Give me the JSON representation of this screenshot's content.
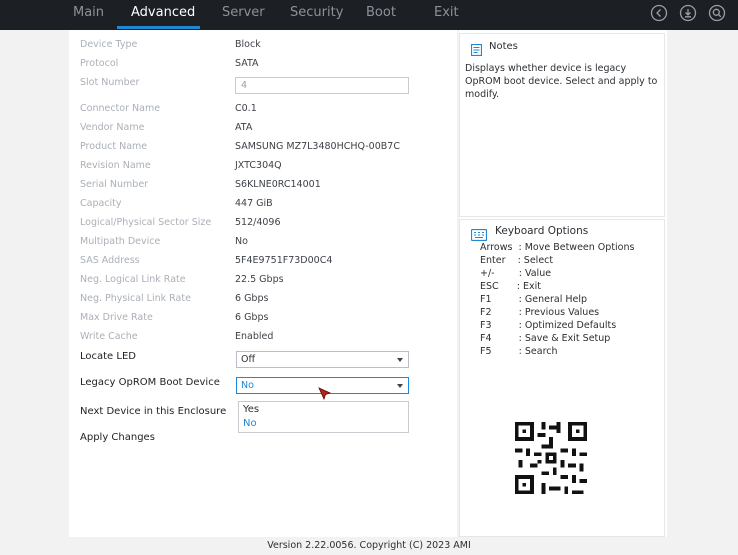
{
  "topbar": {
    "tabs": [
      {
        "label": "Main"
      },
      {
        "label": "Advanced"
      },
      {
        "label": "Server"
      },
      {
        "label": "Security"
      },
      {
        "label": "Boot"
      },
      {
        "label": "Exit"
      }
    ],
    "active_tab": "Advanced"
  },
  "device": {
    "rows": [
      {
        "label": "Device Type",
        "value": "Block"
      },
      {
        "label": "Protocol",
        "value": "SATA"
      },
      {
        "label": "Slot Number",
        "value": "4"
      },
      {
        "label": "Connector Name",
        "value": "C0.1"
      },
      {
        "label": "Vendor Name",
        "value": "ATA"
      },
      {
        "label": "Product Name",
        "value": "SAMSUNG MZ7L3480HCHQ-00B7C"
      },
      {
        "label": "Revision Name",
        "value": "JXTC304Q"
      },
      {
        "label": "Serial Number",
        "value": "S6KLNE0RC14001"
      },
      {
        "label": "Capacity",
        "value": "447 GiB"
      },
      {
        "label": "Logical/Physical Sector Size",
        "value": "512/4096"
      },
      {
        "label": "Multipath Device",
        "value": "No"
      },
      {
        "label": "SAS Address",
        "value": "5F4E9751F73D00C4"
      },
      {
        "label": "Neg. Logical Link Rate",
        "value": "22.5 Gbps"
      },
      {
        "label": "Neg. Physical Link Rate",
        "value": "6 Gbps"
      },
      {
        "label": "Max Drive Rate",
        "value": "6 Gbps"
      },
      {
        "label": "Write Cache",
        "value": "Enabled"
      }
    ],
    "locate_led": {
      "label": "Locate LED",
      "value": "Off"
    },
    "legacy_oprom": {
      "label": "Legacy OpROM Boot Device",
      "value": "No"
    },
    "next_device": {
      "label": "Next Device in this Enclosure"
    },
    "apply_changes": {
      "label": "Apply Changes"
    },
    "dropdown_options": [
      "Yes",
      "No"
    ],
    "dropdown_selected": "No"
  },
  "notes": {
    "title": "Notes",
    "text": "Displays whether device is legacy OpROM boot device. Select and apply to modify."
  },
  "keyboard": {
    "title": "Keyboard Options",
    "items": [
      "Arrows  : Move Between Options",
      "Enter    : Select",
      "+/-        : Value",
      "ESC      : Exit",
      "F1         : General Help",
      "F2         : Previous Values",
      "F3         : Optimized Defaults",
      "F4         : Save & Exit Setup",
      "F5         : Search"
    ]
  },
  "footer": {
    "text": "Version 2.22.0056. Copyright (C) 2023 AMI"
  },
  "colors": {
    "accent": "#1e88d6",
    "topbar": "#1c1f24"
  }
}
